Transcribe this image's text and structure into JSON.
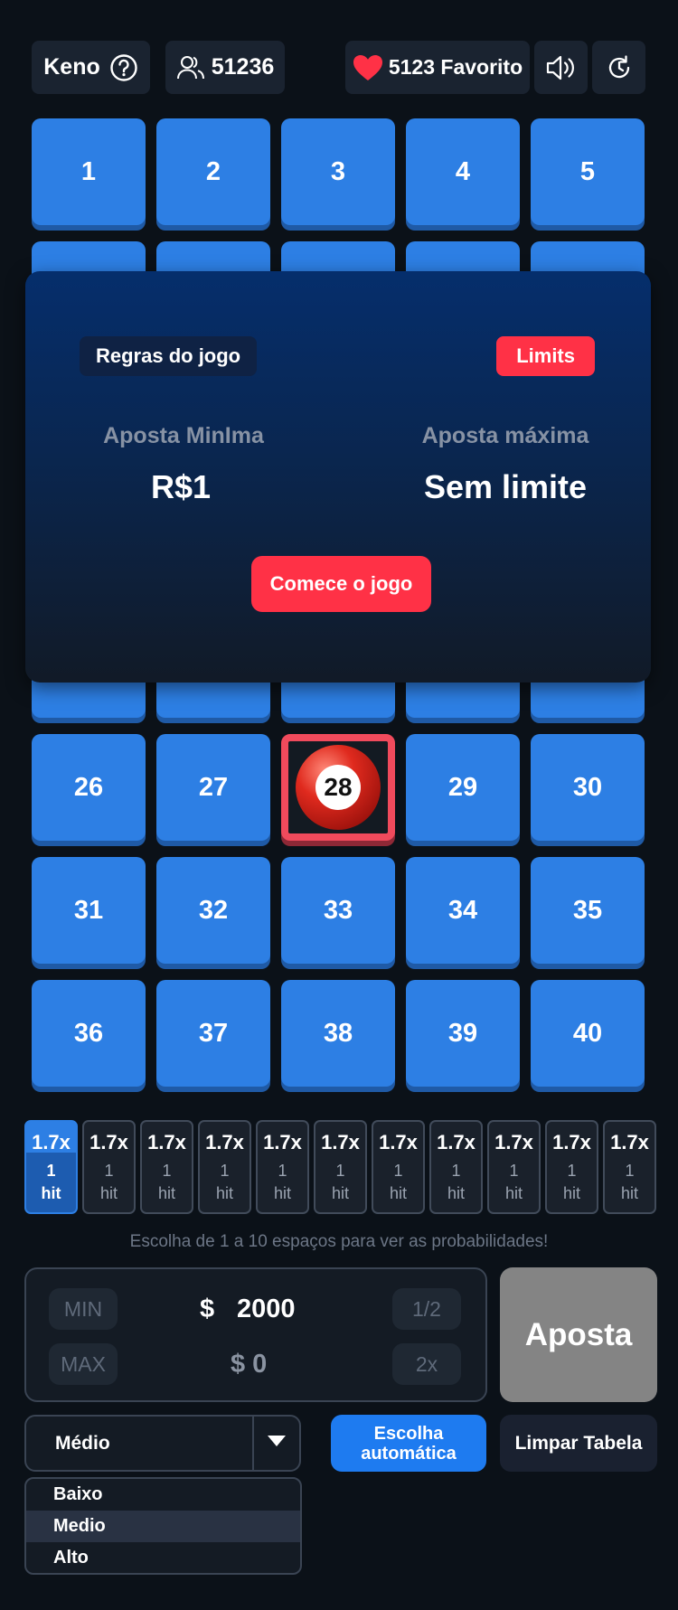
{
  "header": {
    "game_name": "Keno",
    "players_count": "51236",
    "favorite_label": "5123 Favorito",
    "accent_heart": "#ff3146"
  },
  "grid": {
    "visible_top_numbers": [
      "1",
      "2",
      "3",
      "4",
      "5"
    ],
    "rows": [
      [
        "26",
        "27",
        "28",
        "29",
        "30"
      ],
      [
        "31",
        "32",
        "33",
        "34",
        "35"
      ],
      [
        "36",
        "37",
        "38",
        "39",
        "40"
      ]
    ],
    "selected_number": "28",
    "tile_color": "#2d7fe4"
  },
  "modal": {
    "rules_label": "Regras do jogo",
    "limits_label": "Limits",
    "min_bet_label": "Aposta MinIma",
    "min_bet_value": "R$1",
    "max_bet_label": "Aposta máxima",
    "max_bet_value": "Sem limite",
    "start_label": "Comece o jogo"
  },
  "payouts": [
    {
      "multiplier": "1.7x",
      "count": "1",
      "unit": "hit",
      "active": true
    },
    {
      "multiplier": "1.7x",
      "count": "1",
      "unit": "hit",
      "active": false
    },
    {
      "multiplier": "1.7x",
      "count": "1",
      "unit": "hit",
      "active": false
    },
    {
      "multiplier": "1.7x",
      "count": "1",
      "unit": "hit",
      "active": false
    },
    {
      "multiplier": "1.7x",
      "count": "1",
      "unit": "hit",
      "active": false
    },
    {
      "multiplier": "1.7x",
      "count": "1",
      "unit": "hit",
      "active": false
    },
    {
      "multiplier": "1.7x",
      "count": "1",
      "unit": "hit",
      "active": false
    },
    {
      "multiplier": "1.7x",
      "count": "1",
      "unit": "hit",
      "active": false
    },
    {
      "multiplier": "1.7x",
      "count": "1",
      "unit": "hit",
      "active": false
    },
    {
      "multiplier": "1.7x",
      "count": "1",
      "unit": "hit",
      "active": false
    },
    {
      "multiplier": "1.7x",
      "count": "1",
      "unit": "hit",
      "active": false
    }
  ],
  "hint": "Escolha de 1 a 10 espaços para ver as probabilidades!",
  "bet": {
    "min_label": "MIN",
    "max_label": "MAX",
    "half_label": "1/2",
    "double_label": "2x",
    "currency": "$",
    "amount": "2000",
    "payout": "$ 0",
    "place_label": "Aposta"
  },
  "risk": {
    "selected": "Médio",
    "options": [
      "Baixo",
      "Medio",
      "Alto"
    ],
    "highlighted_option": "Medio"
  },
  "auto_label": "Escolha automática",
  "clear_label": "Limpar Tabela"
}
